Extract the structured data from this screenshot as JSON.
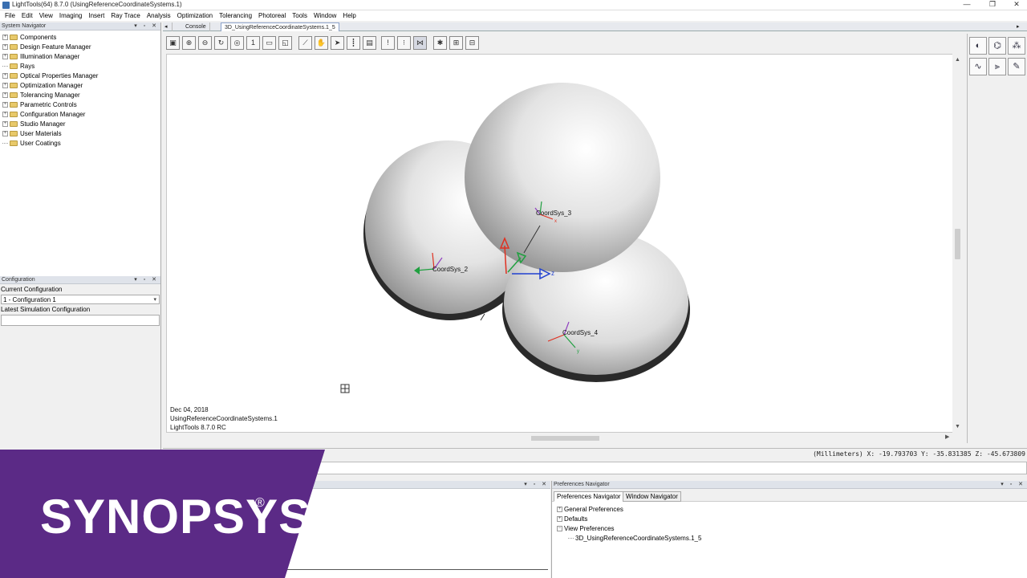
{
  "window": {
    "title": "LightTools(64) 8.7.0  (UsingReferenceCoordinateSystems.1)",
    "controls": [
      "—",
      "❐",
      "✕"
    ]
  },
  "menu": [
    "File",
    "Edit",
    "View",
    "Imaging",
    "Insert",
    "Ray Trace",
    "Analysis",
    "Optimization",
    "Tolerancing",
    "Photoreal",
    "Tools",
    "Window",
    "Help"
  ],
  "system_navigator": {
    "title": "System Navigator",
    "items": [
      {
        "label": "Components",
        "expandable": true
      },
      {
        "label": "Design Feature Manager",
        "expandable": true
      },
      {
        "label": "Illumination Manager",
        "expandable": true
      },
      {
        "label": "Rays",
        "expandable": false
      },
      {
        "label": "Optical Properties Manager",
        "expandable": true
      },
      {
        "label": "Optimization Manager",
        "expandable": true
      },
      {
        "label": "Tolerancing Manager",
        "expandable": true
      },
      {
        "label": "Parametric Controls",
        "expandable": true
      },
      {
        "label": "Configuration Manager",
        "expandable": true
      },
      {
        "label": "Studio Manager",
        "expandable": true
      },
      {
        "label": "User Materials",
        "expandable": true
      },
      {
        "label": "User Coatings",
        "expandable": false
      }
    ]
  },
  "configuration": {
    "title": "Configuration",
    "current_label": "Current Configuration",
    "current_value": "1 - Configuration 1",
    "latest_label": "Latest Simulation Configuration",
    "latest_value": ""
  },
  "tabs": [
    {
      "label": "Console",
      "active": false
    },
    {
      "label": "3D_UsingReferenceCoordinateSystems.1_5",
      "active": true
    }
  ],
  "viewport": {
    "stamp_date": "Dec 04, 2018",
    "stamp_file": "UsingReferenceCoordinateSystems.1",
    "stamp_version": "LightTools 8.7.0 RC",
    "coordsys_labels": [
      "CoordSys_3",
      "CoordSys_2",
      "CoordSys_4"
    ],
    "axis_z_label": "z",
    "axis_x_label": "x",
    "axis_y_label": "y"
  },
  "status": {
    "coords": "(Millimeters) X: -19.793703 Y: -35.831385 Z: -45.673809"
  },
  "preferences_navigator": {
    "title": "Preferences Navigator",
    "tabs": [
      {
        "label": "Preferences Navigator",
        "active": true
      },
      {
        "label": "Window Navigator",
        "active": false
      }
    ],
    "tree": [
      {
        "label": "General Preferences",
        "indent": 0,
        "expanded": false
      },
      {
        "label": "Defaults",
        "indent": 0,
        "expanded": false
      },
      {
        "label": "View Preferences",
        "indent": 0,
        "expanded": true
      },
      {
        "label": "3D_UsingReferenceCoordinateSystems.1_5",
        "indent": 1,
        "expanded": false
      }
    ]
  },
  "brand": {
    "name": "SYNOPSYS",
    "mark": "®",
    "color": "#5b2a86"
  },
  "colors": {
    "axis_x": "#e03020",
    "axis_y": "#20a040",
    "axis_z": "#2040d0",
    "axis_other": "#9040c0"
  }
}
